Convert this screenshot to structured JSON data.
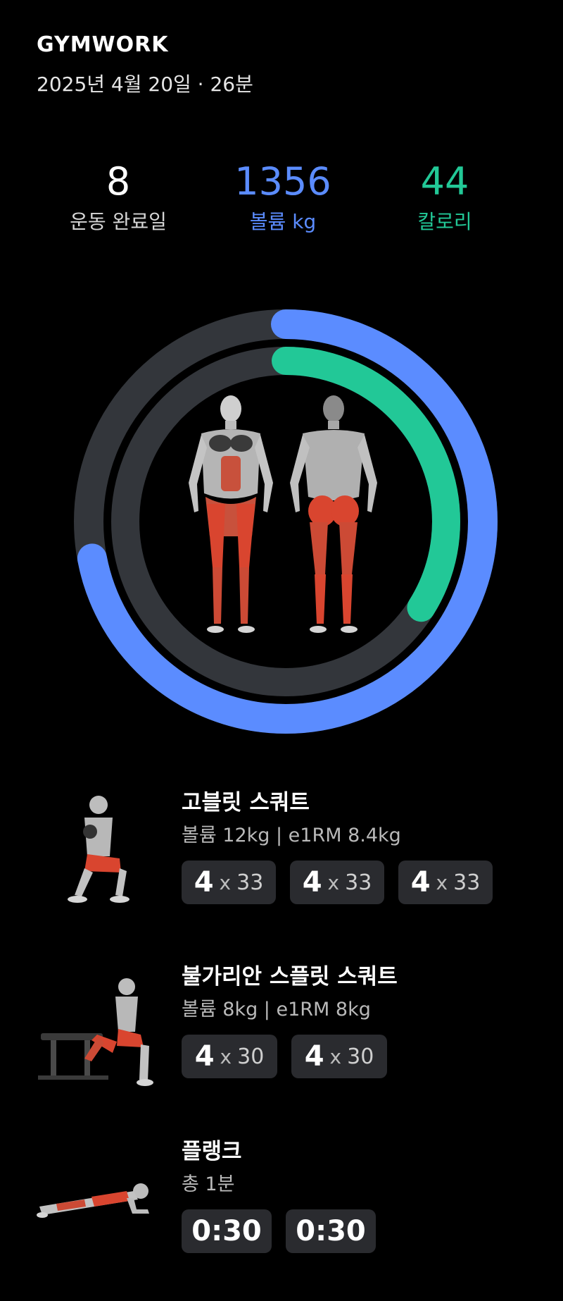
{
  "header": {
    "logo": "GYMWORK",
    "date": "2025년 4월 20일 · 26분"
  },
  "stats": [
    {
      "value": "8",
      "label": "운동 완료일"
    },
    {
      "value": "1356",
      "label": "볼륨 kg"
    },
    {
      "value": "44",
      "label": "칼로리"
    }
  ],
  "colors": {
    "blue": "#5b8cff",
    "green": "#22c897",
    "track": "#33363b",
    "chip": "#2a2b2f"
  },
  "rings": {
    "outer_progress": 0.72,
    "inner_progress": 0.34
  },
  "exercises": [
    {
      "name": "고블릿 스쿼트",
      "sub": "볼륨 12kg | e1RM 8.4kg",
      "sets": [
        {
          "a": "4",
          "x": "x",
          "b": "33"
        },
        {
          "a": "4",
          "x": "x",
          "b": "33"
        },
        {
          "a": "4",
          "x": "x",
          "b": "33"
        }
      ]
    },
    {
      "name": "불가리안 스플릿 스쿼트",
      "sub": "볼륨 8kg | e1RM 8kg",
      "sets": [
        {
          "a": "4",
          "x": "x",
          "b": "30"
        },
        {
          "a": "4",
          "x": "x",
          "b": "30"
        }
      ]
    },
    {
      "name": "플랭크",
      "sub": "총 1분",
      "sets": [
        "0:30",
        "0:30"
      ]
    }
  ]
}
